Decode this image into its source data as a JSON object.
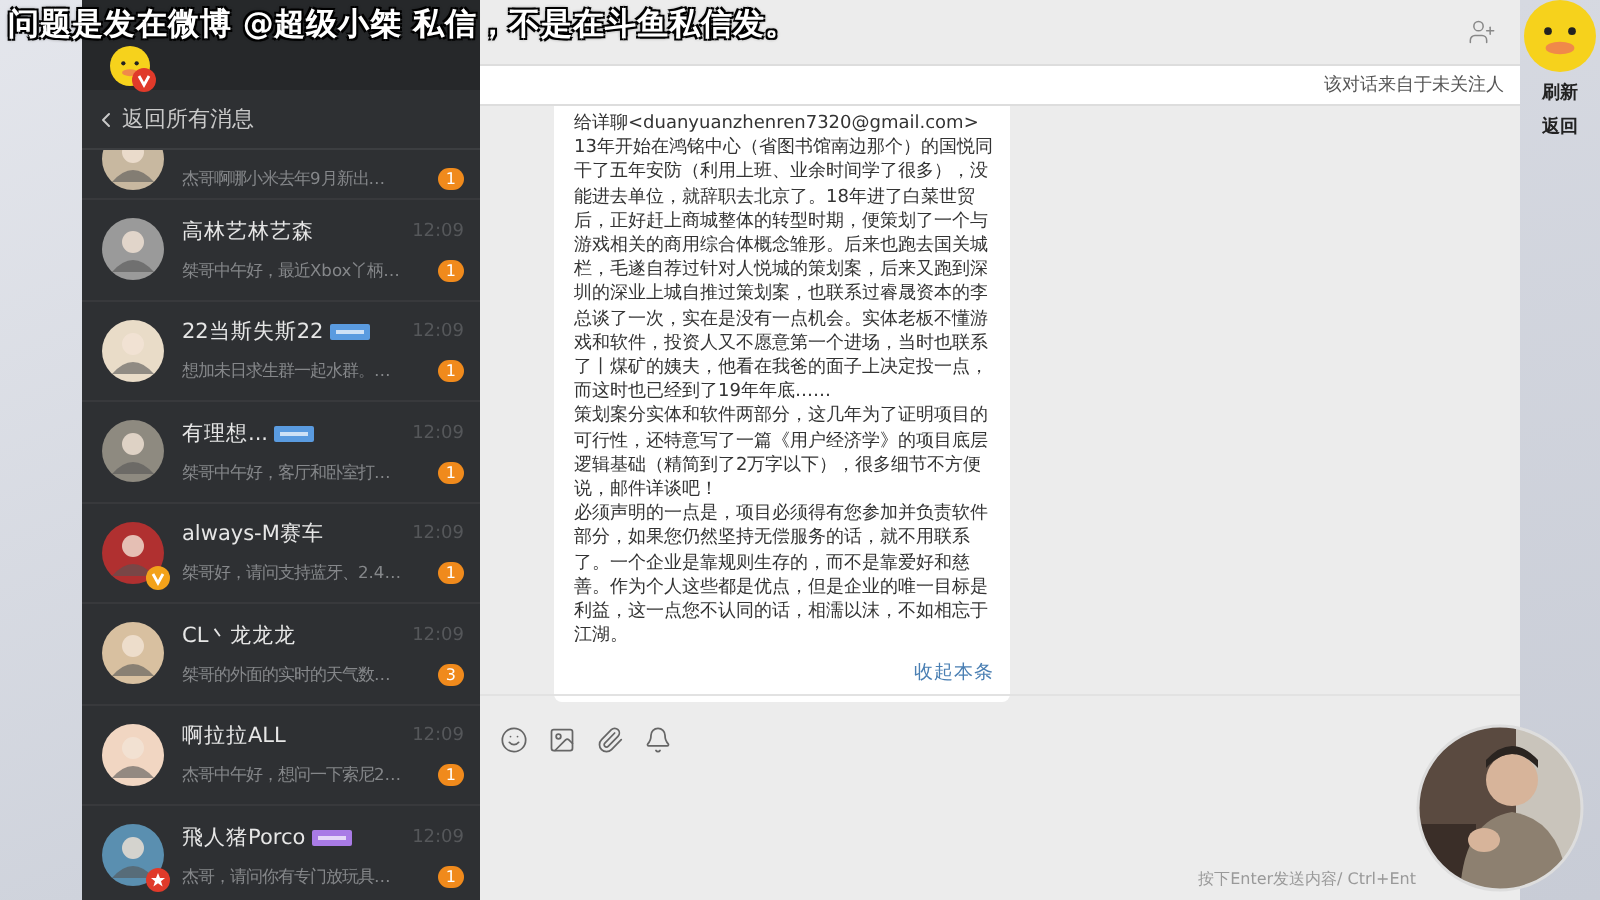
{
  "overlay_caption": "问题是发在微博 @超级小桀 私信，不是在斗鱼私信发。",
  "sidebar": {
    "back_link": "返回所有消息",
    "conversations": [
      {
        "preview": "杰哥啊哪小米去年9月新出…",
        "unread": "1"
      },
      {
        "name": "高林艺林艺森",
        "preview": "桀哥中午好，最近Xbox丫柄…",
        "time": "12:09",
        "unread": "1"
      },
      {
        "name": "22当斯失斯22",
        "preview": "想加未日求生群一起水群。…",
        "time": "12:09",
        "unread": "1",
        "tag": {
          "color": "#5a9be0"
        }
      },
      {
        "name": "有理想...",
        "preview": "桀哥中午好，客厅和卧室打…",
        "time": "12:09",
        "unread": "1",
        "tag": {
          "color": "#5a9be0"
        }
      },
      {
        "name": "always-M赛车",
        "preview": "桀哥好，请问支持蓝牙、2.4…",
        "time": "12:09",
        "unread": "1",
        "badge": {
          "kind": "v",
          "color": "#f3a21a"
        }
      },
      {
        "name": "CL丶龙龙龙",
        "preview": "桀哥的外面的实时的天气数…",
        "time": "12:09",
        "unread": "3"
      },
      {
        "name": "啊拉拉ALL",
        "preview": "杰哥中午好，想问一下索尼2…",
        "time": "12:09",
        "unread": "1"
      },
      {
        "name": "飛人猪Porco",
        "preview": "杰哥，请问你有专门放玩具…",
        "time": "12:09",
        "unread": "1",
        "tag": {
          "color": "#a97be6"
        },
        "badge": {
          "kind": "star",
          "color": "#e03a2a"
        }
      }
    ]
  },
  "chat": {
    "notice": "该对话来自于未关注人",
    "message_paragraphs": [
      "给详聊<duanyuanzhenren7320@gmail.com>",
      "13年开始在鸿铭中心（省图书馆南边那个）的国悦同干了五年安防（利用上班、业余时间学了很多），没能进去单位，就辞职去北京了。18年进了白菜世贸后，正好赶上商城整体的转型时期，便策划了一个与游戏相关的商用综合体概念雏形。后来也跑去国关城栏，毛遂自荐过针对人悦城的策划案，后来又跑到深圳的深业上城自推过策划案，也联系过睿晟资本的李总谈了一次，实在是没有一点机会。实体老板不懂游戏和软件，投资人又不愿意第一个进场，当时也联系了丨煤矿的姨夫，他看在我爸的面子上决定投一点，而这时也已经到了19年年底……",
      "策划案分实体和软件两部分，这几年为了证明项目的可行性，还特意写了一篇《用户经济学》的项目底层逻辑基础（精简到了2万字以下），很多细节不方便说，邮件详谈吧！",
      "必须声明的一点是，项目必须得有您参加并负责软件部分，如果您仍然坚持无偿服务的话，就不用联系了。一个企业是靠规则生存的，而不是靠爱好和慈善。作为个人这些都是优点，但是企业的唯一目标是利益，这一点您不认同的话，相濡以沫，不如相忘于江湖。"
    ],
    "collapse_link": "收起本条",
    "input_hint": "按下Enter发送内容/ Ctrl+Ent"
  },
  "right_strip": {
    "refresh": "刷新",
    "back": "返回"
  }
}
